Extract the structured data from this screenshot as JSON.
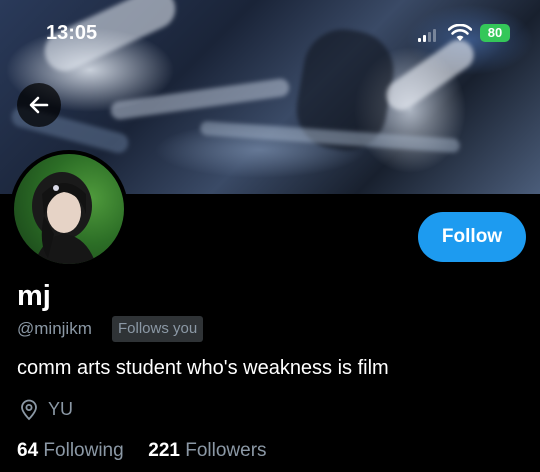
{
  "status_bar": {
    "time": "13:05",
    "battery": "80"
  },
  "profile": {
    "display_name": "mj",
    "handle": "@minjikm",
    "follows_you_label": "Follows you",
    "bio": "comm arts student who's weakness is film",
    "location": "YU",
    "following_count": "64",
    "following_label": "Following",
    "followers_count": "221",
    "followers_label": "Followers"
  },
  "actions": {
    "follow_label": "Follow"
  },
  "colors": {
    "accent": "#1d9bf0",
    "secondary_text": "#8b98a5",
    "battery": "#34c759",
    "background": "#000000"
  },
  "icons": {
    "back": "arrow-left-icon",
    "location": "map-pin-icon",
    "wifi": "wifi-icon",
    "signal": "cellular-signal-icon"
  }
}
